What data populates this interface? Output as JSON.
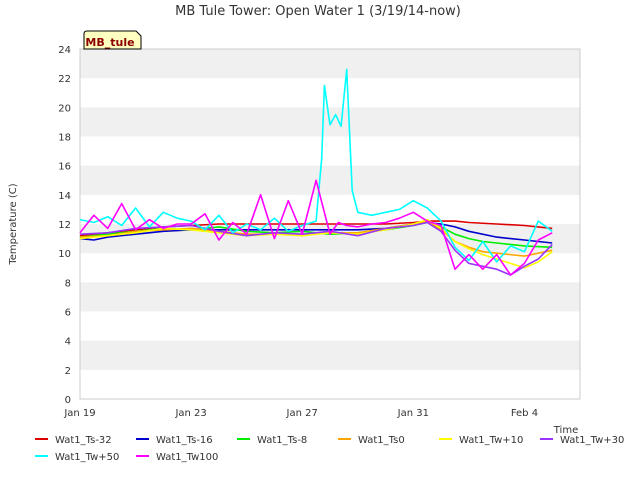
{
  "chart_data": {
    "type": "line",
    "title": "MB Tule Tower: Open Water 1 (3/19/14-now)",
    "xlabel": "Time",
    "ylabel": "Temperature (C)",
    "ylim": [
      0,
      24
    ],
    "xlim": [
      0,
      18
    ],
    "yticks": [
      0,
      2,
      4,
      6,
      8,
      10,
      12,
      14,
      16,
      18,
      20,
      22,
      24
    ],
    "xticks": [
      {
        "x": 0,
        "label": "Jan 19"
      },
      {
        "x": 4,
        "label": "Jan 23"
      },
      {
        "x": 8,
        "label": "Jan 27"
      },
      {
        "x": 12,
        "label": "Jan 31"
      },
      {
        "x": 16,
        "label": "Feb 4"
      }
    ],
    "grid": "horizontal bands",
    "legend_placement": "bottom",
    "annotation": "MB_tule",
    "series": [
      {
        "name": "Wat1_Ts-32",
        "color": "#dd0000",
        "x": [
          0,
          1,
          2,
          3,
          4,
          5,
          6,
          7,
          8,
          9,
          10,
          11,
          12,
          12.5,
          13,
          13.5,
          14,
          15,
          16,
          17
        ],
        "y": [
          11.2,
          11.4,
          11.6,
          11.8,
          11.9,
          12.0,
          12.0,
          12.0,
          12.0,
          12.0,
          12.0,
          12.0,
          12.1,
          12.2,
          12.2,
          12.2,
          12.1,
          12.0,
          11.9,
          11.7
        ]
      },
      {
        "name": "Wat1_Ts-16",
        "color": "#0000cc",
        "x": [
          0,
          0.5,
          1,
          2,
          3,
          4,
          5,
          6,
          7,
          8,
          9,
          10,
          11,
          12,
          12.5,
          13,
          13.5,
          14,
          15,
          16,
          17
        ],
        "y": [
          11.0,
          10.9,
          11.1,
          11.3,
          11.5,
          11.6,
          11.6,
          11.6,
          11.6,
          11.6,
          11.6,
          11.6,
          11.7,
          12.0,
          12.1,
          12.0,
          11.8,
          11.5,
          11.1,
          10.9,
          10.7
        ]
      },
      {
        "name": "Wat1_Ts-8",
        "color": "#00ee00",
        "x": [
          0,
          1,
          2,
          3,
          4,
          5,
          6,
          7,
          8,
          9,
          10,
          11,
          12,
          12.5,
          13,
          13.5,
          14,
          14.5,
          15,
          16,
          17
        ],
        "y": [
          11.1,
          11.3,
          11.5,
          11.7,
          11.6,
          11.8,
          11.5,
          11.4,
          11.5,
          11.3,
          11.4,
          11.6,
          11.9,
          12.1,
          11.8,
          11.3,
          11.0,
          10.8,
          10.7,
          10.5,
          10.4
        ]
      },
      {
        "name": "Wat1_Ts0",
        "color": "#ffa500",
        "x": [
          0,
          1,
          2,
          3,
          4,
          5,
          6,
          7,
          8,
          9,
          10,
          11,
          12,
          12.5,
          13,
          13.5,
          14,
          14.5,
          15,
          16,
          17
        ],
        "y": [
          11.1,
          11.2,
          11.5,
          11.6,
          11.7,
          11.5,
          11.3,
          11.3,
          11.3,
          11.4,
          11.4,
          11.7,
          12.0,
          12.2,
          11.6,
          10.8,
          10.4,
          10.1,
          10.0,
          9.8,
          10.2
        ]
      },
      {
        "name": "Wat1_Tw+10",
        "color": "#ffff00",
        "x": [
          0,
          1,
          2,
          3,
          4,
          5,
          6,
          7,
          8,
          9,
          10,
          11,
          12,
          12.5,
          13,
          13.5,
          14,
          14.5,
          15,
          15.5,
          16,
          16.5,
          17
        ],
        "y": [
          11.0,
          11.2,
          11.4,
          11.7,
          11.6,
          11.4,
          11.2,
          11.3,
          11.2,
          11.4,
          11.3,
          11.6,
          12.0,
          12.3,
          11.7,
          10.8,
          10.3,
          9.9,
          9.6,
          9.3,
          9.0,
          9.4,
          10.1
        ]
      },
      {
        "name": "Wat1_Tw+30",
        "color": "#9933ff",
        "x": [
          0,
          1,
          2,
          3,
          4,
          5,
          6,
          7,
          8,
          9,
          10,
          11,
          12,
          12.5,
          13,
          13.5,
          14,
          14.5,
          15,
          15.5,
          16,
          16.5,
          17
        ],
        "y": [
          11.3,
          11.4,
          11.7,
          11.8,
          11.9,
          11.5,
          11.2,
          11.4,
          11.3,
          11.5,
          11.2,
          11.7,
          11.9,
          12.1,
          11.5,
          10.2,
          9.3,
          9.1,
          8.9,
          8.5,
          9.1,
          9.6,
          10.6
        ]
      },
      {
        "name": "Wat1_Tw+50",
        "color": "#00ffff",
        "x": [
          0,
          0.5,
          1,
          1.5,
          2,
          2.5,
          3,
          3.5,
          4,
          4.5,
          5,
          5.5,
          6,
          6.5,
          7,
          7.5,
          8,
          8.5,
          8.7,
          8.8,
          9,
          9.2,
          9.4,
          9.6,
          9.8,
          10,
          10.5,
          11,
          11.5,
          12,
          12.5,
          13,
          13.5,
          14,
          14.5,
          15,
          15.5,
          16,
          16.5,
          17
        ],
        "y": [
          12.3,
          12.1,
          12.5,
          11.9,
          13.1,
          11.8,
          12.8,
          12.4,
          12.2,
          11.6,
          12.6,
          11.4,
          12.0,
          11.6,
          12.4,
          11.5,
          11.9,
          12.2,
          16.5,
          21.5,
          18.8,
          19.5,
          18.7,
          22.6,
          14.3,
          12.8,
          12.6,
          12.8,
          13.0,
          13.6,
          13.1,
          12.2,
          10.4,
          9.5,
          10.8,
          9.4,
          10.5,
          10.1,
          12.2,
          11.5
        ]
      },
      {
        "name": "Wat1_Tw100",
        "color": "#ff00ff",
        "x": [
          0,
          0.5,
          1,
          1.5,
          2,
          2.5,
          3,
          3.5,
          4,
          4.5,
          5,
          5.5,
          6,
          6.5,
          7,
          7.5,
          8,
          8.5,
          9,
          9.3,
          9.6,
          10,
          10.5,
          11,
          11.5,
          12,
          12.5,
          13,
          13.5,
          14,
          14.5,
          15,
          15.5,
          16,
          16.5,
          17
        ],
        "y": [
          11.4,
          12.6,
          11.7,
          13.4,
          11.6,
          12.3,
          11.7,
          12.0,
          12.0,
          12.7,
          10.9,
          12.1,
          11.3,
          14.0,
          11.0,
          13.6,
          11.3,
          15.0,
          11.3,
          12.1,
          11.9,
          11.8,
          12.0,
          12.1,
          12.4,
          12.8,
          12.2,
          11.9,
          8.9,
          9.9,
          8.9,
          9.9,
          8.5,
          9.3,
          10.9,
          11.4
        ]
      }
    ]
  }
}
